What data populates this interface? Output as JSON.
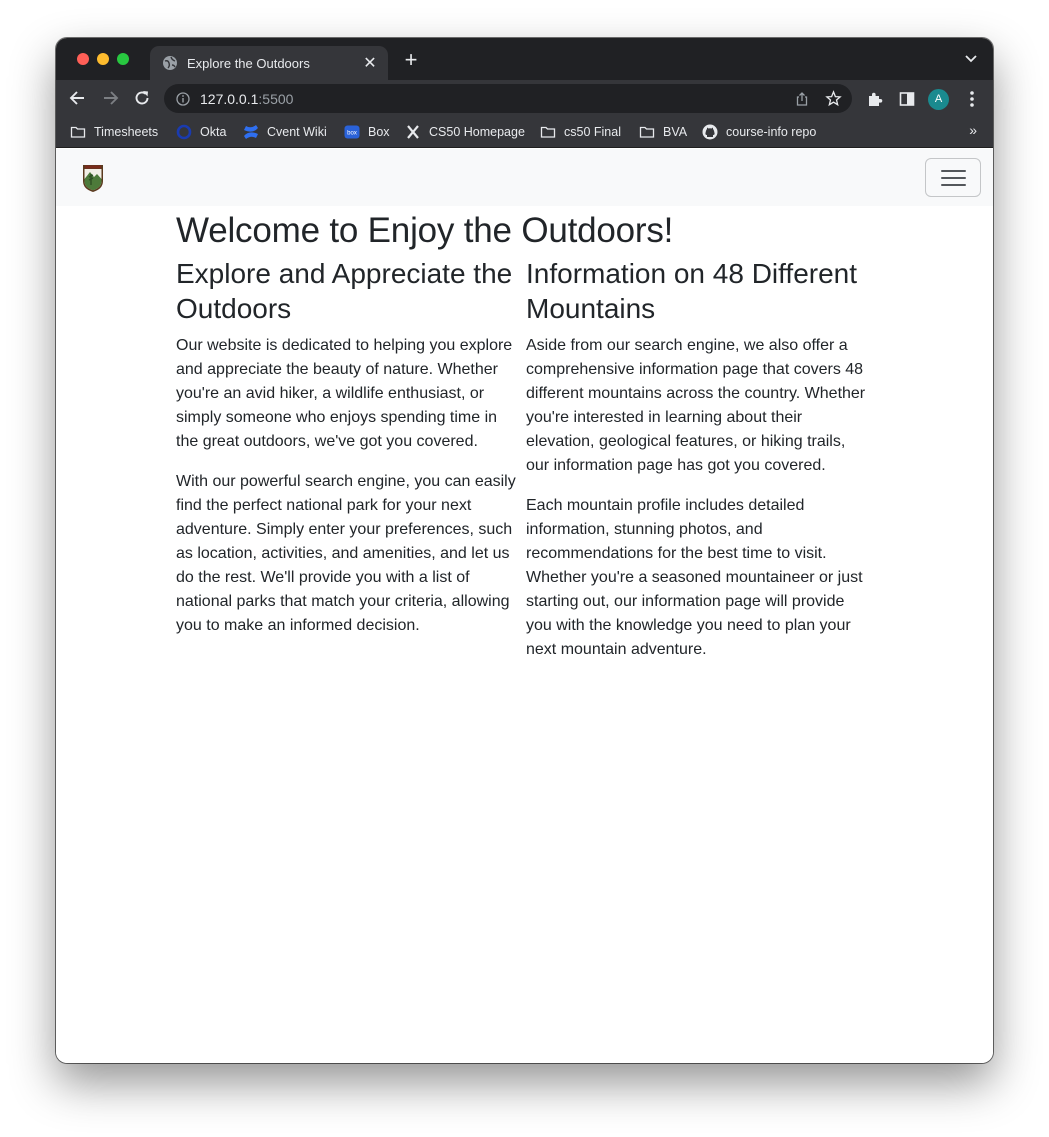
{
  "browser": {
    "tab_title": "Explore the Outdoors",
    "url_host": "127.0.0.1",
    "url_port": ":5500",
    "avatar_letter": "A",
    "bookmarks": [
      {
        "label": "Timesheets",
        "icon": "folder-icon"
      },
      {
        "label": "Okta",
        "icon": "okta-icon"
      },
      {
        "label": "Cvent Wiki",
        "icon": "confluence-icon"
      },
      {
        "label": "Box",
        "icon": "box-icon"
      },
      {
        "label": "CS50 Homepage",
        "icon": "cs50-icon"
      },
      {
        "label": "cs50 Final",
        "icon": "folder-icon"
      },
      {
        "label": "BVA",
        "icon": "folder-icon"
      },
      {
        "label": "course-info repo",
        "icon": "github-icon"
      }
    ],
    "bookmarks_more": "»"
  },
  "page": {
    "heading": "Welcome to Enjoy the Outdoors!",
    "columns": [
      {
        "title": "Explore and Appreciate the Outdoors",
        "paragraphs": [
          "Our website is dedicated to helping you explore and appreciate the beauty of nature. Whether you're an avid hiker, a wildlife enthusiast, or simply someone who enjoys spending time in the great outdoors, we've got you covered.",
          "With our powerful search engine, you can easily find the perfect national park for your next adventure. Simply enter your preferences, such as location, activities, and amenities, and let us do the rest. We'll provide you with a list of national parks that match your criteria, allowing you to make an informed decision."
        ]
      },
      {
        "title": "Information on 48 Different Mountains",
        "paragraphs": [
          "Aside from our search engine, we also offer a comprehensive information page that covers 48 different mountains across the country. Whether you're interested in learning about their elevation, geological features, or hiking trails, our information page has got you covered.",
          "Each mountain profile includes detailed information, stunning photos, and recommendations for the best time to visit. Whether you're a seasoned mountaineer or just starting out, our information page will provide you with the knowledge you need to plan your next mountain adventure."
        ]
      }
    ]
  }
}
